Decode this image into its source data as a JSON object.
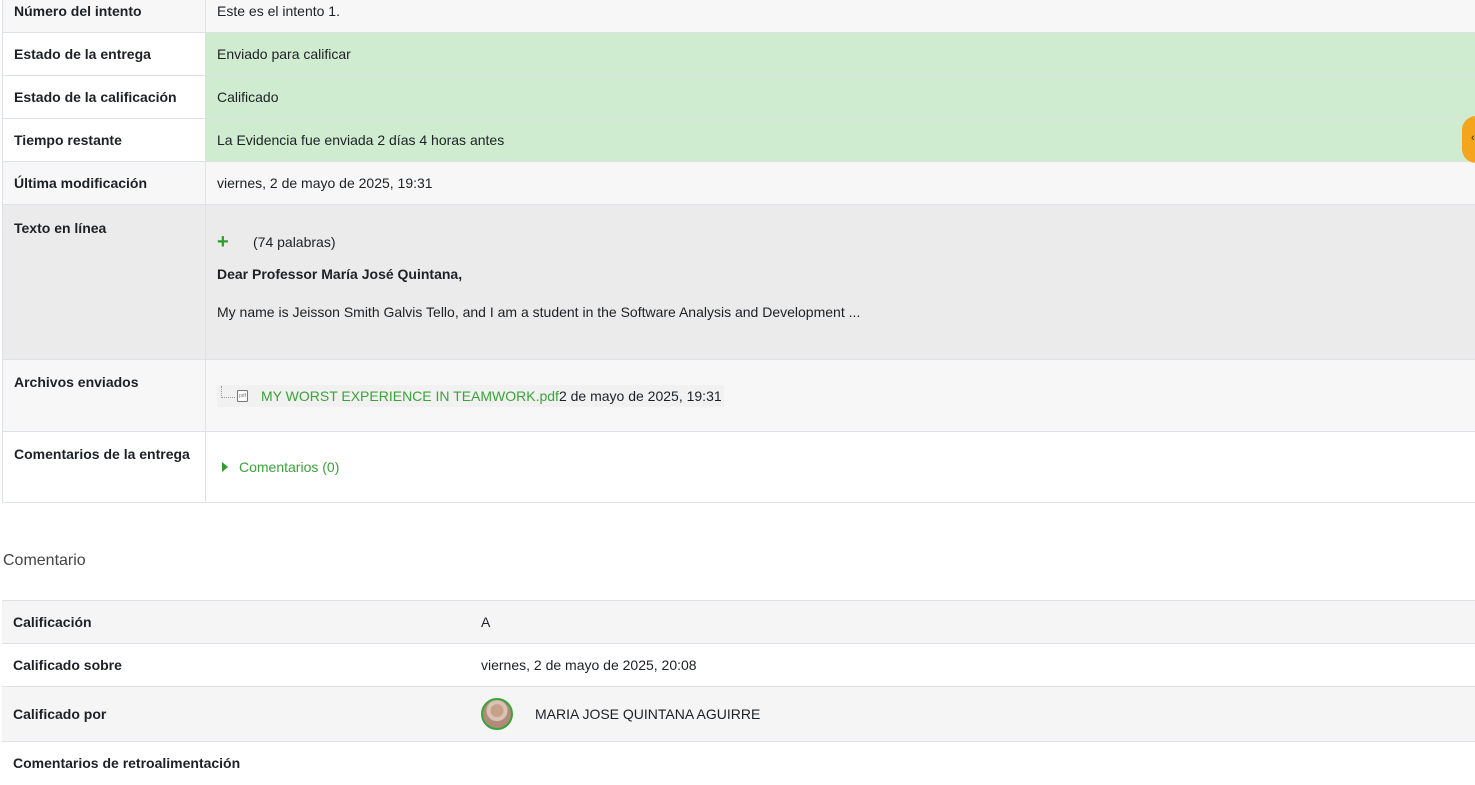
{
  "submission": {
    "rows": [
      {
        "label": "Número del intento",
        "value": "Este es el intento 1."
      },
      {
        "label": "Estado de la entrega",
        "value": "Enviado para calificar"
      },
      {
        "label": "Estado de la calificación",
        "value": "Calificado"
      },
      {
        "label": "Tiempo restante",
        "value": "La Evidencia fue enviada 2 días 4 horas antes"
      },
      {
        "label": "Última modificación",
        "value": "viernes, 2 de mayo de 2025, 19:31"
      }
    ],
    "online_text": {
      "label": "Texto en línea",
      "word_count": "(74 palabras)",
      "greeting": "Dear Professor María José Quintana,",
      "excerpt": "My name is Jeisson Smith Galvis Tello, and I am a student in the Software Analysis and Development ..."
    },
    "files": {
      "label": "Archivos enviados",
      "file_name": "MY WORST EXPERIENCE IN TEAMWORK.pdf",
      "file_date": "2 de mayo de 2025, 19:31"
    },
    "comments": {
      "label": "Comentarios de la entrega",
      "toggle": "Comentarios (0)"
    }
  },
  "feedback": {
    "heading": "Comentario",
    "rows": [
      {
        "label": "Calificación",
        "value": "A"
      },
      {
        "label": "Calificado sobre",
        "value": "viernes, 2 de mayo de 2025, 20:08"
      },
      {
        "label": "Calificado por",
        "value": "MARIA JOSE QUINTANA AGUIRRE"
      },
      {
        "label": "Comentarios de retroalimentación",
        "value": ""
      }
    ]
  },
  "colors": {
    "success_bg": "#d0ecd0",
    "link": "#3aa33a",
    "side_tab": "#f4a51c"
  },
  "icons": [
    "plus-icon",
    "file-pdf-icon",
    "caret-right-icon",
    "user-avatar"
  ]
}
